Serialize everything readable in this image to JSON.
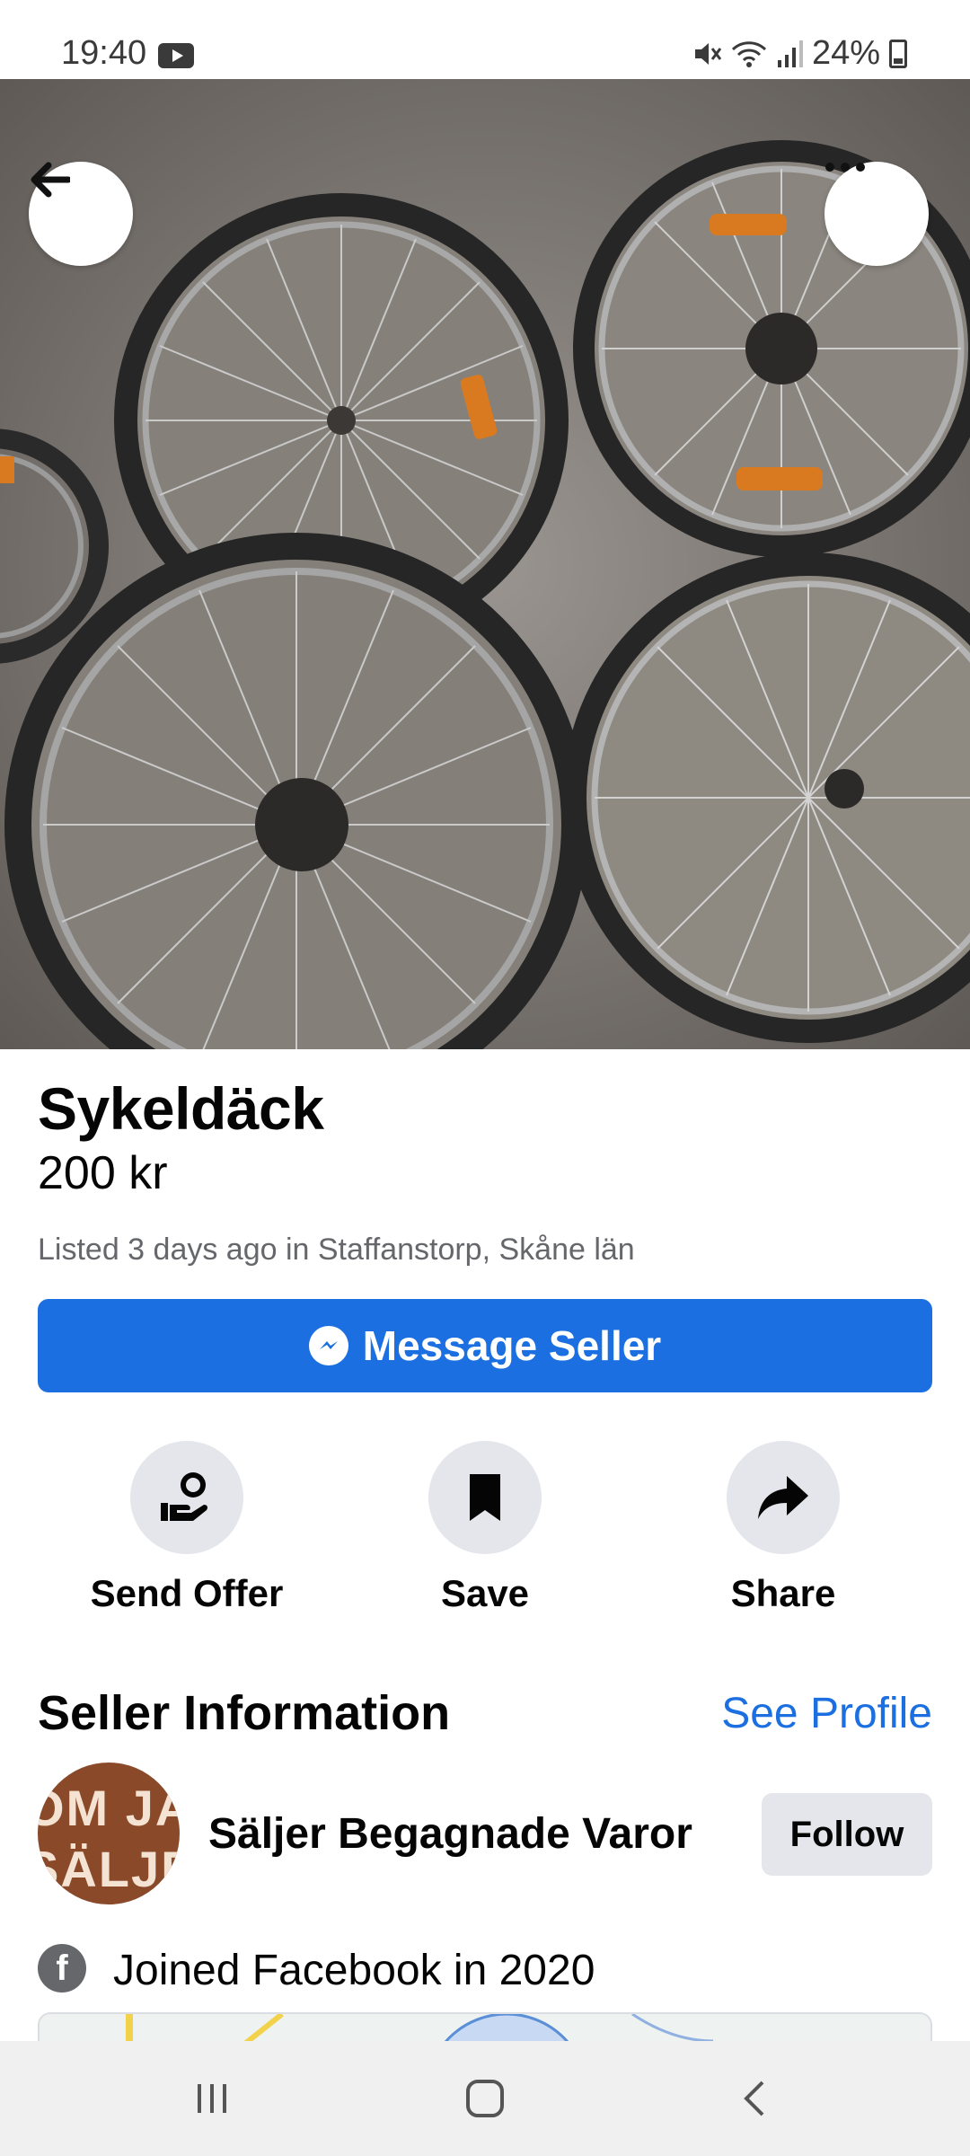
{
  "status_bar": {
    "time": "19:40",
    "battery": "24%"
  },
  "listing": {
    "title": "Sykeldäck",
    "price": "200 kr",
    "meta": "Listed 3 days ago in Staffanstorp, Skåne län",
    "message_button": "Message Seller"
  },
  "actions": [
    {
      "label": "Send Offer",
      "icon": "send-offer-icon"
    },
    {
      "label": "Save",
      "icon": "bookmark-icon"
    },
    {
      "label": "Share",
      "icon": "share-arrow-icon"
    }
  ],
  "seller": {
    "heading": "Seller Information",
    "see_profile": "See Profile",
    "avatar_text_top": "OM JAG",
    "avatar_text_bottom": "SÄLJER",
    "name": "Säljer Begagnade Varor",
    "follow": "Follow",
    "joined": "Joined Facebook in 2020"
  },
  "colors": {
    "accent": "#1b6fe0",
    "button_grey": "#e4e6eb",
    "secondary_text": "#65676b"
  }
}
